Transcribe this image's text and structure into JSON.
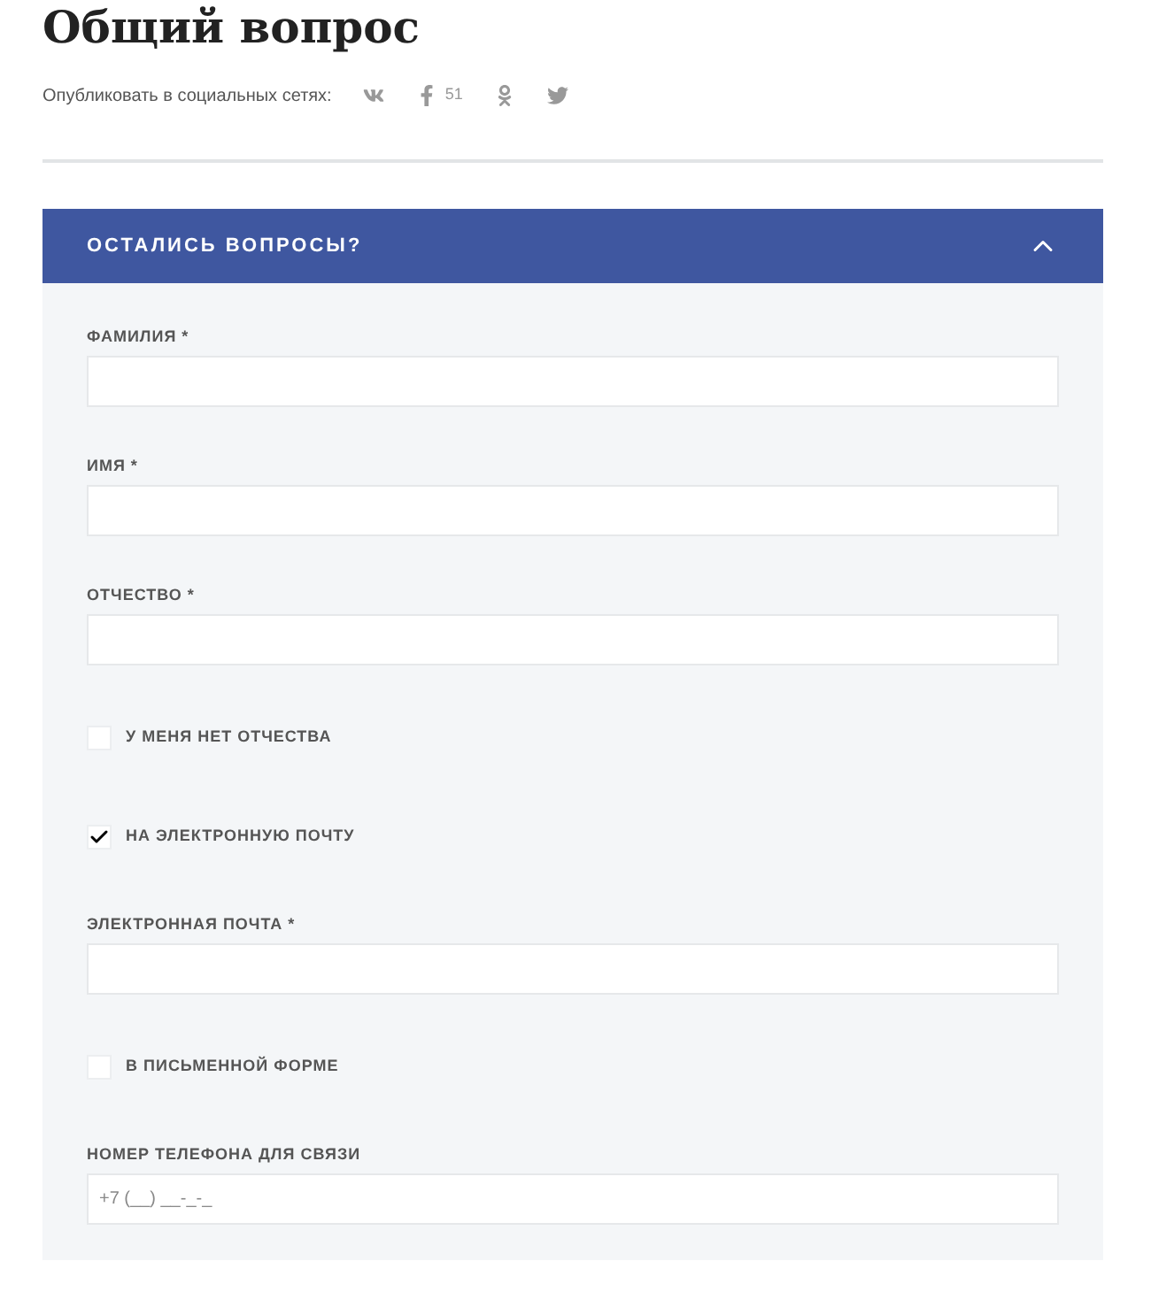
{
  "title": "Общий вопрос",
  "share": {
    "label": "Опубликовать в социальных сетях:",
    "networks": [
      {
        "kind": "vk"
      },
      {
        "kind": "facebook",
        "count": "51"
      },
      {
        "kind": "ok"
      },
      {
        "kind": "twitter"
      }
    ]
  },
  "panel": {
    "title": "ОСТАЛИСЬ ВОПРОСЫ?",
    "expanded": true,
    "items": [
      {
        "kind": "field",
        "label": "ФАМИЛИЯ *"
      },
      {
        "kind": "field",
        "label": "ИМЯ *"
      },
      {
        "kind": "field",
        "label": "ОТЧЕСТВО *"
      },
      {
        "kind": "checkbox",
        "label": "У МЕНЯ НЕТ ОТЧЕСТВА",
        "checked": false
      },
      {
        "kind": "checkbox",
        "label": "НА ЭЛЕКТРОННУЮ ПОЧТУ",
        "checked": true
      },
      {
        "kind": "field",
        "label": "ЭЛЕКТРОННАЯ ПОЧТА *"
      },
      {
        "kind": "checkbox",
        "label": "В ПИСЬМЕННОЙ ФОРМЕ",
        "checked": false
      },
      {
        "kind": "field",
        "label": "НОМЕР ТЕЛЕФОНА ДЛЯ СВЯЗИ",
        "placeholder": "+7 (__) __-_-_"
      }
    ]
  }
}
